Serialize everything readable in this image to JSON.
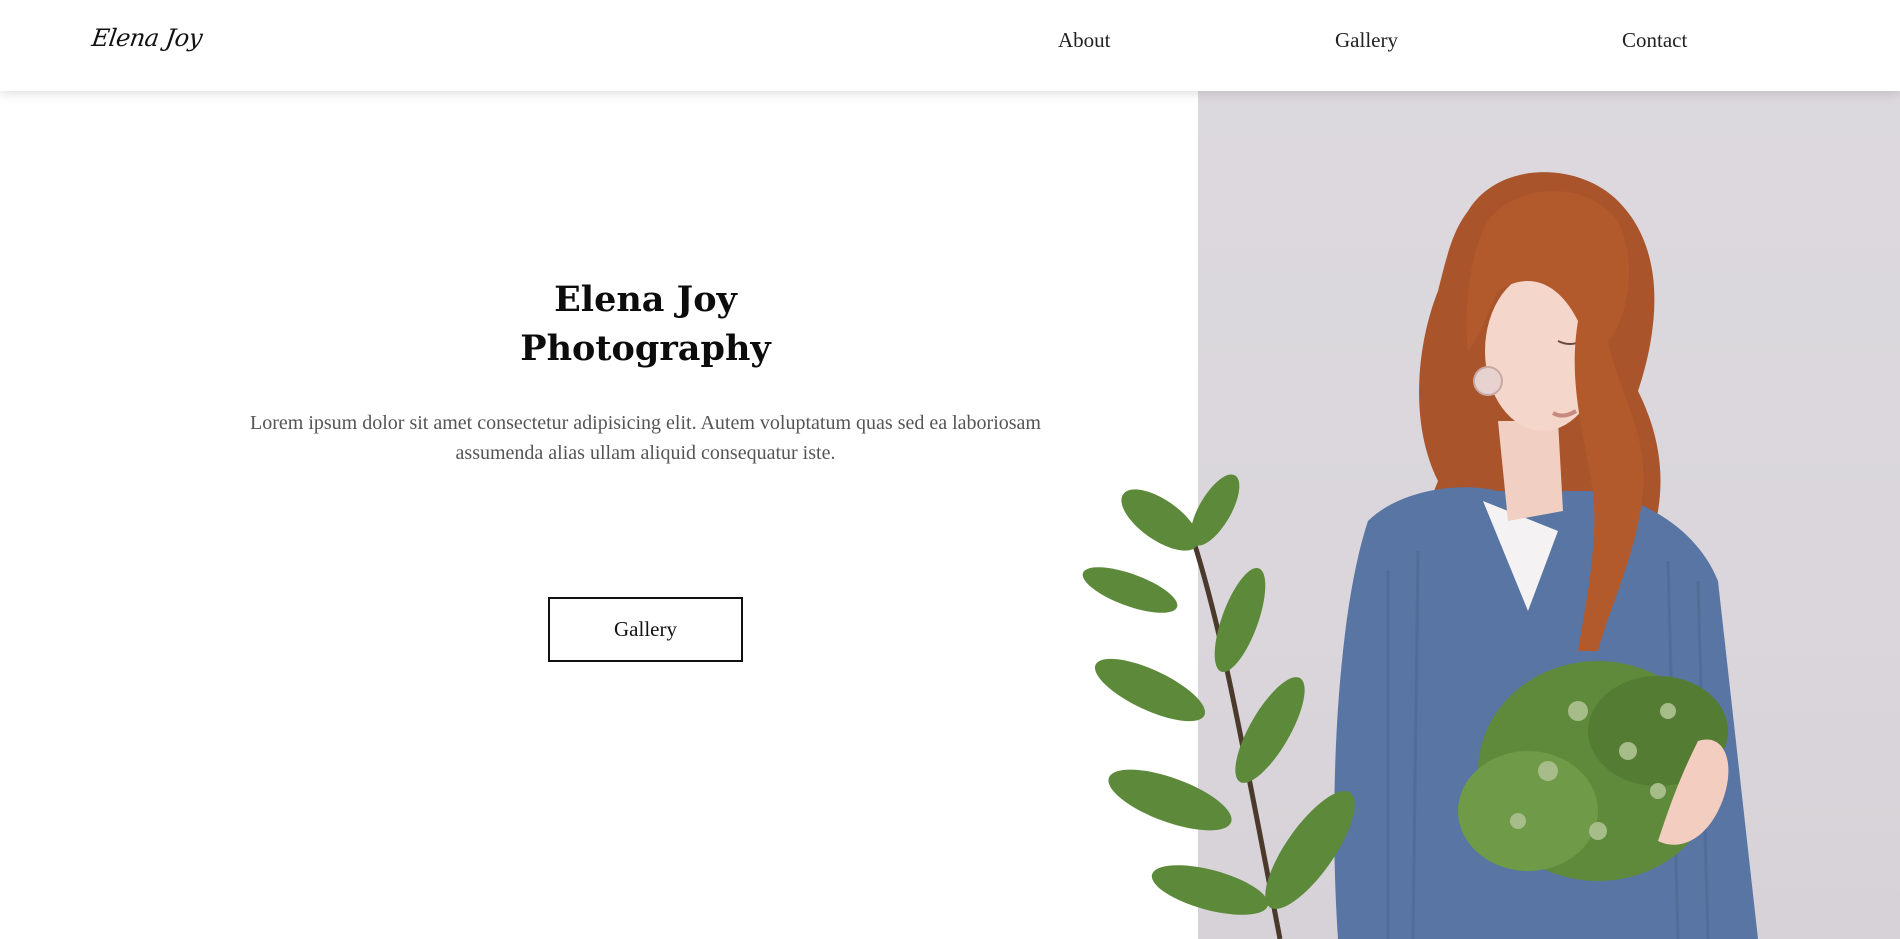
{
  "nav": {
    "logo": "Elena Joy",
    "links": [
      {
        "label": "About"
      },
      {
        "label": "Gallery"
      },
      {
        "label": "Contact"
      }
    ]
  },
  "hero": {
    "title_line1": "Elena Joy",
    "title_line2": "Photography",
    "text": "Lorem ipsum dolor sit amet consectetur adipisicing elit. Autem voluptatum quas sed ea laboriosam assumenda alias ullam aliquid consequatur iste.",
    "button_label": "Gallery"
  },
  "colors": {
    "background": "#ffffff",
    "photo_backdrop": "#dcd9de",
    "cardigan": "#5875a3",
    "hair": "#b35a2c",
    "leaves": "#5f8a3c"
  },
  "icons": {
    "hero_image": "woman-with-flowers-photo"
  }
}
